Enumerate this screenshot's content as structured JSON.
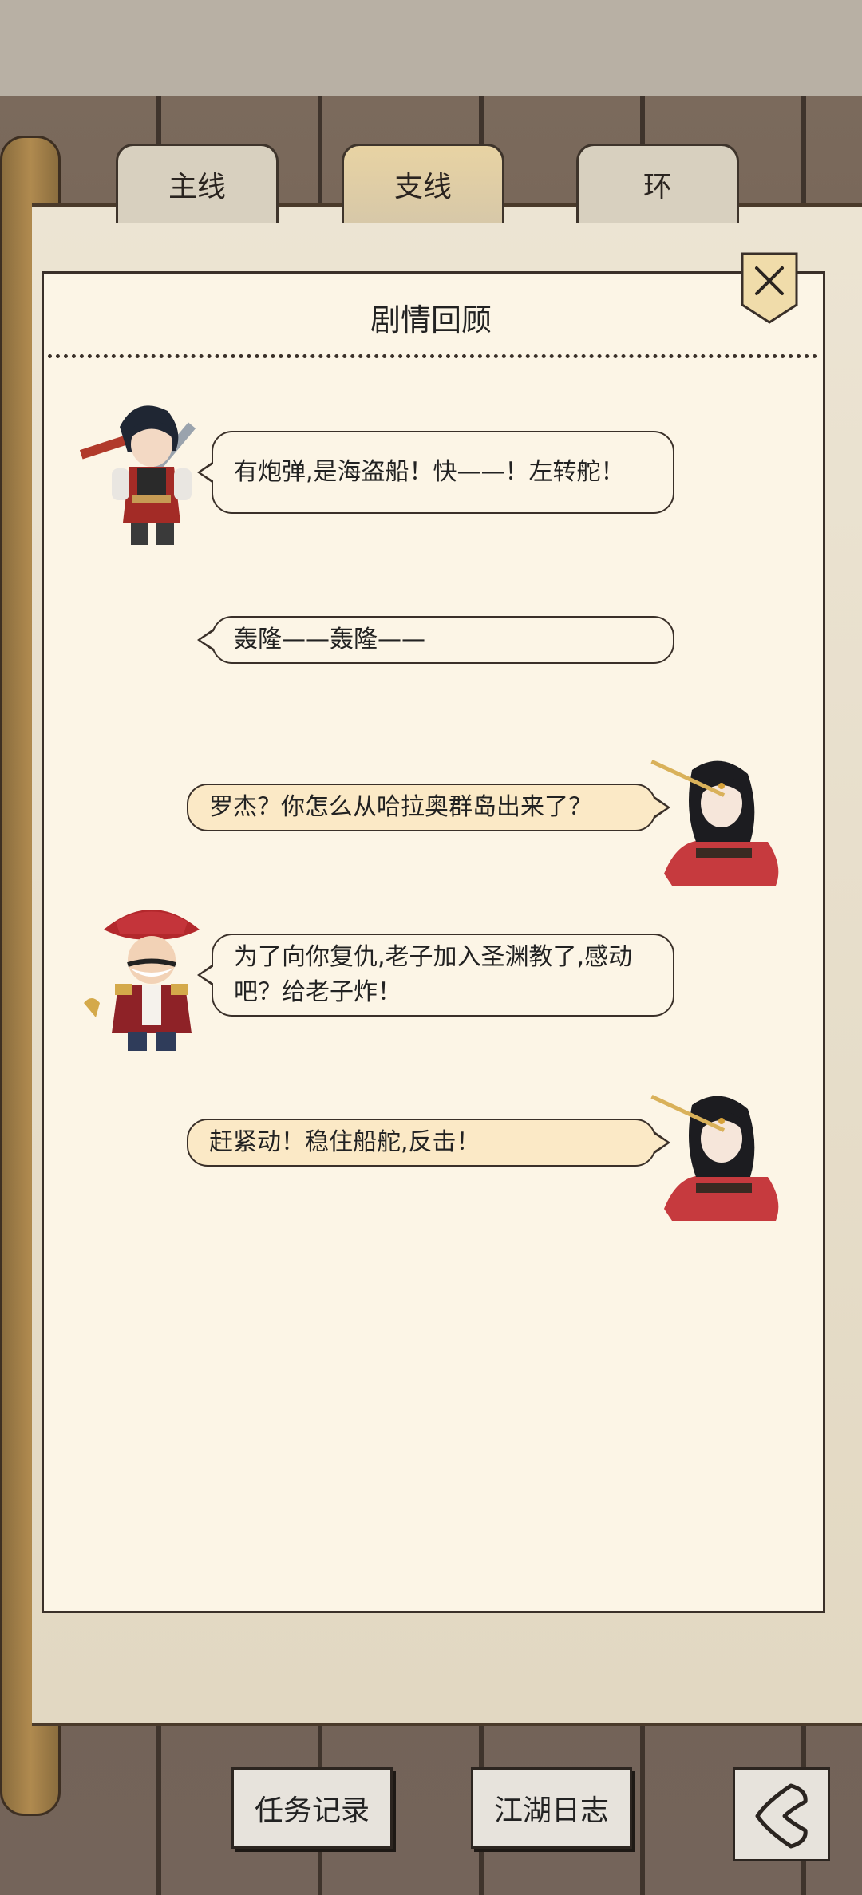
{
  "tabs": [
    {
      "label": "主线",
      "active": false
    },
    {
      "label": "支线",
      "active": true
    },
    {
      "label": "环",
      "active": false
    }
  ],
  "panel": {
    "title": "剧情回顾"
  },
  "dialogue": [
    {
      "side": "left",
      "portrait": "swordsman-portrait",
      "text": "有炮弹,是海盗船！快——！左转舵！"
    },
    {
      "side": "left",
      "portrait": "none",
      "text": "轰隆——轰隆——"
    },
    {
      "side": "right",
      "portrait": "heroine-portrait",
      "text": "罗杰？你怎么从哈拉奥群岛出来了？"
    },
    {
      "side": "left",
      "portrait": "pirate-captain-portrait",
      "text": "为了向你复仇,老子加入圣渊教了,感动吧？给老子炸！"
    },
    {
      "side": "right",
      "portrait": "heroine-portrait",
      "text": "赶紧动！稳住船舵,反击！"
    }
  ],
  "bottom": {
    "quest_log": "任务记录",
    "jianghu_journal": "江湖日志"
  },
  "icons": {
    "close": "close-icon",
    "back": "back-arrow-icon"
  },
  "colors": {
    "panel_bg": "#fcf5e6",
    "right_bubble_bg": "#fbe9c6",
    "active_tab": "#e8d3a3"
  }
}
